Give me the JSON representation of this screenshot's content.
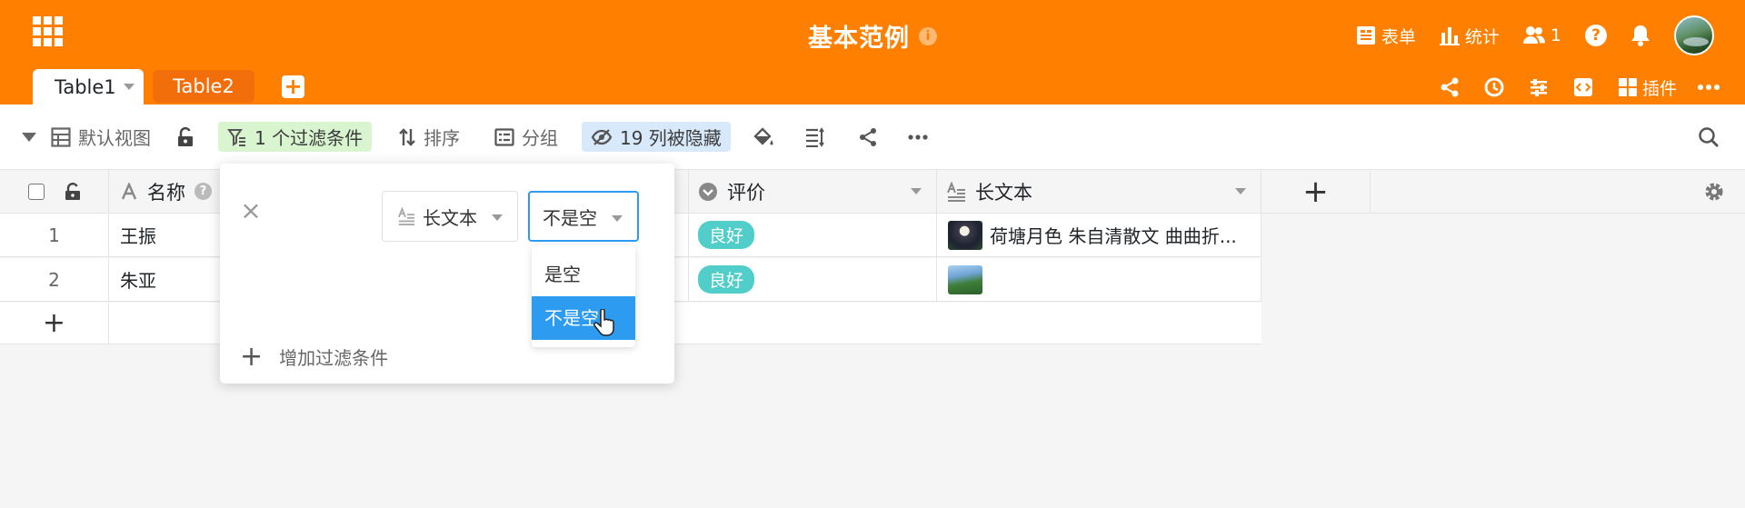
{
  "colors": {
    "header_bg": "#ff8000",
    "tab_inactive": "#f26e0b",
    "filter_badge": "#d9f5d0",
    "hidden_badge": "#d8e9fb",
    "tag": "#52ceca",
    "select_focus": "#2d9bf0"
  },
  "header": {
    "apps_icon": "apps-grid-icon",
    "title": "基本范例",
    "info_icon": "i",
    "right": {
      "form_label": "表单",
      "stats_label": "统计",
      "collaborators_count": "1",
      "help_icon": "?"
    }
  },
  "tabs": {
    "active": "Table1",
    "inactive": "Table2",
    "add": "+"
  },
  "tab_tools": {
    "plugins_label": "插件"
  },
  "toolbar": {
    "view_name": "默认视图",
    "filter_label": "1 个过滤条件",
    "sort_label": "排序",
    "group_label": "分组",
    "hidden_label": "19 列被隐藏"
  },
  "columns": {
    "name": "名称",
    "rating": "评价",
    "longtext": "长文本",
    "add": "+"
  },
  "rows": [
    {
      "index": "1",
      "name": "王振",
      "rating": "良好",
      "longtext": "荷塘月色 朱自清散文 曲曲折..."
    },
    {
      "index": "2",
      "name": "朱亚",
      "rating": "良好",
      "longtext": ""
    }
  ],
  "add_row": "+",
  "filter": {
    "close": "×",
    "column_select": "长文本",
    "condition_select": "不是空",
    "options": [
      "是空",
      "不是空"
    ],
    "selected_option": "不是空",
    "add_label": "增加过滤条件",
    "add_plus": "+"
  }
}
